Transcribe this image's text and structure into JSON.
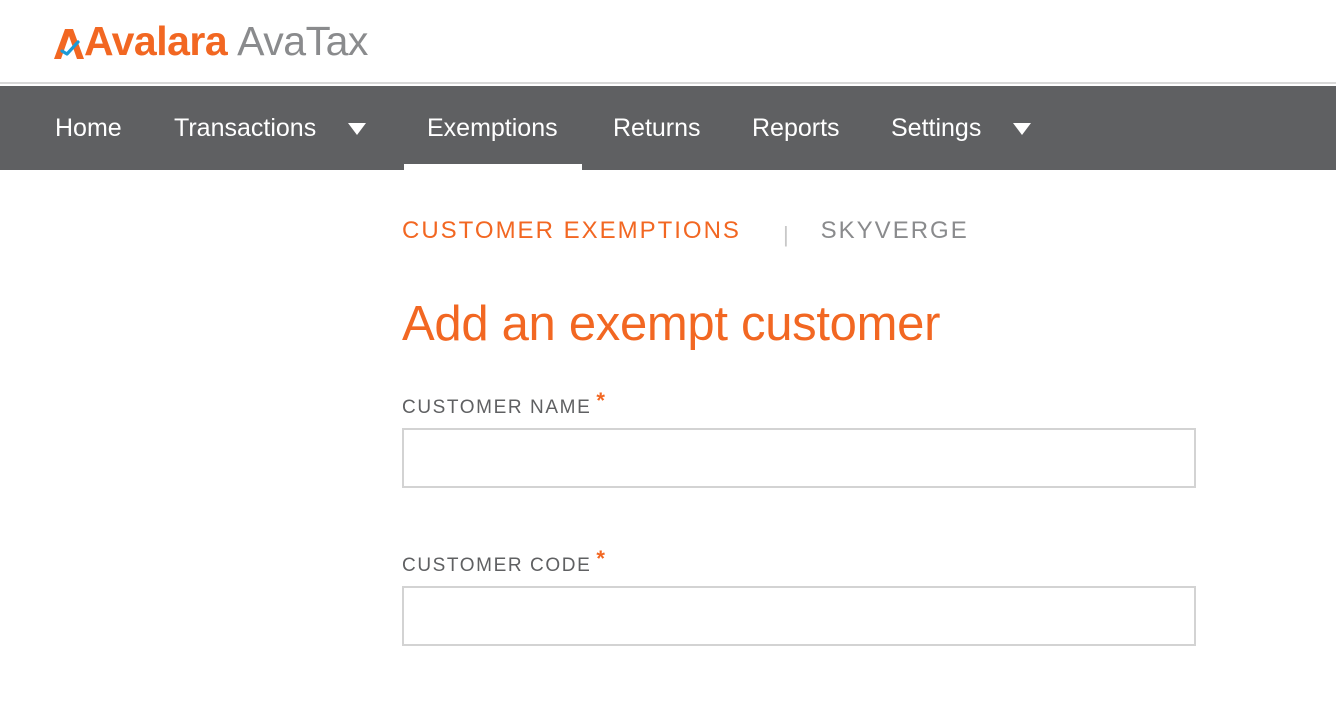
{
  "header": {
    "brand": "Avalara",
    "product": "AvaTax",
    "brand_color": "#f26722",
    "product_color": "#8a8b8d"
  },
  "nav": {
    "background": "#5f6062",
    "items": [
      {
        "label": "Home",
        "has_dropdown": false,
        "active": false
      },
      {
        "label": "Transactions",
        "has_dropdown": true,
        "active": false
      },
      {
        "label": "Exemptions",
        "has_dropdown": false,
        "active": true
      },
      {
        "label": "Returns",
        "has_dropdown": false,
        "active": false
      },
      {
        "label": "Reports",
        "has_dropdown": false,
        "active": false
      },
      {
        "label": "Settings",
        "has_dropdown": true,
        "active": false
      }
    ]
  },
  "breadcrumb": {
    "primary": "CUSTOMER EXEMPTIONS",
    "separator": "|",
    "secondary": "SKYVERGE"
  },
  "page": {
    "title": "Add an exempt customer"
  },
  "form": {
    "customer_name": {
      "label": "CUSTOMER NAME",
      "required_mark": "*",
      "value": "",
      "placeholder": ""
    },
    "customer_code": {
      "label": "CUSTOMER CODE",
      "required_mark": "*",
      "value": "",
      "placeholder": ""
    }
  }
}
